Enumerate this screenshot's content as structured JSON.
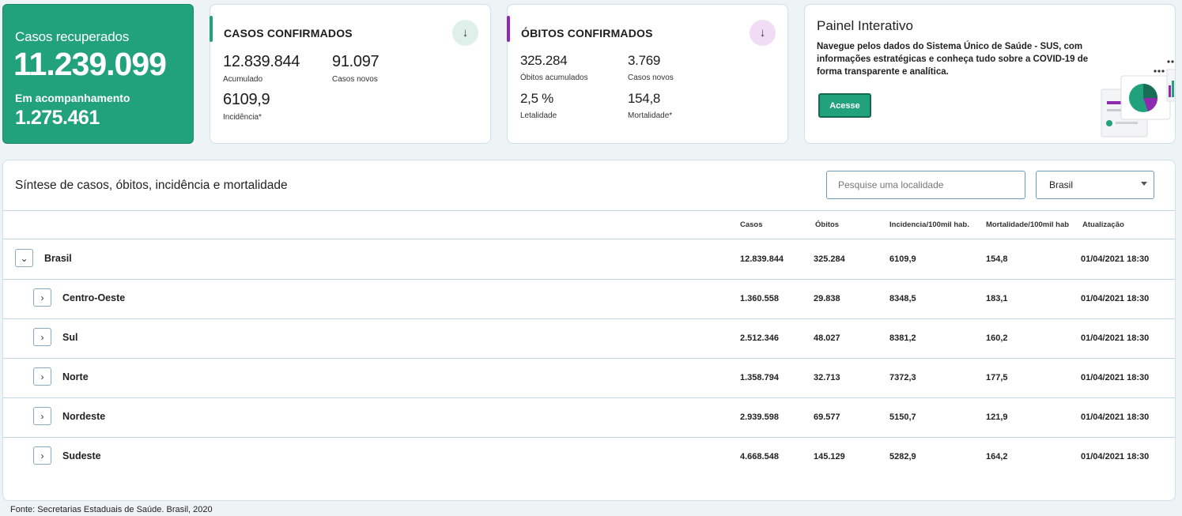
{
  "recovered": {
    "label": "Casos recuperados",
    "value": "11.239.099",
    "follow_label": "Em acompanhamento",
    "follow_value": "1.275.461"
  },
  "confirmed": {
    "title": "CASOS CONFIRMADOS",
    "accumulated": "12.839.844",
    "accumulated_label": "Acumulado",
    "new_cases": "91.097",
    "new_cases_label": "Casos novos",
    "incidence": "6109,9",
    "incidence_label": "Incidência*",
    "accent": "#21a27c"
  },
  "deaths": {
    "title": "ÓBITOS CONFIRMADOS",
    "accumulated": "325.284",
    "accumulated_label": "Óbitos acumulados",
    "new_cases": "3.769",
    "new_cases_label": "Casos novos",
    "lethality": "2,5 %",
    "lethality_label": "Letalidade",
    "mortality": "154,8",
    "mortality_label": "Mortalidade*",
    "accent": "#8e2bb0"
  },
  "painel": {
    "title": "Painel Interativo",
    "description": "Navegue pelos dados do Sistema Único de Saúde - SUS, com informações estratégicas e conheça tudo sobre a COVID-19 de forma transparente e analítica.",
    "button": "Acesse"
  },
  "table": {
    "title": "Síntese de casos, óbitos, incidência e mortalidade",
    "search_placeholder": "Pesquise uma localidade",
    "select_value": "Brasil",
    "headers": [
      "Casos",
      "Óbitos",
      "Incidencia/100mil hab.",
      "Mortalidade/100mil hab",
      "Atualização"
    ],
    "rows": [
      {
        "name": "Brasil",
        "cases": "12.839.844",
        "deaths": "325.284",
        "incidence": "6109,9",
        "mortality": "154,8",
        "updated": "01/04/2021 18:30"
      },
      {
        "name": "Centro-Oeste",
        "cases": "1.360.558",
        "deaths": "29.838",
        "incidence": "8348,5",
        "mortality": "183,1",
        "updated": "01/04/2021 18:30"
      },
      {
        "name": "Sul",
        "cases": "2.512.346",
        "deaths": "48.027",
        "incidence": "8381,2",
        "mortality": "160,2",
        "updated": "01/04/2021 18:30"
      },
      {
        "name": "Norte",
        "cases": "1.358.794",
        "deaths": "32.713",
        "incidence": "7372,3",
        "mortality": "177,5",
        "updated": "01/04/2021 18:30"
      },
      {
        "name": "Nordeste",
        "cases": "2.939.598",
        "deaths": "69.577",
        "incidence": "5150,7",
        "mortality": "121,9",
        "updated": "01/04/2021 18:30"
      },
      {
        "name": "Sudeste",
        "cases": "4.668.548",
        "deaths": "145.129",
        "incidence": "5282,9",
        "mortality": "164,2",
        "updated": "01/04/2021 18:30"
      }
    ]
  },
  "footer": "Fonte: Secretarias Estaduais de Saúde. Brasil, 2020"
}
